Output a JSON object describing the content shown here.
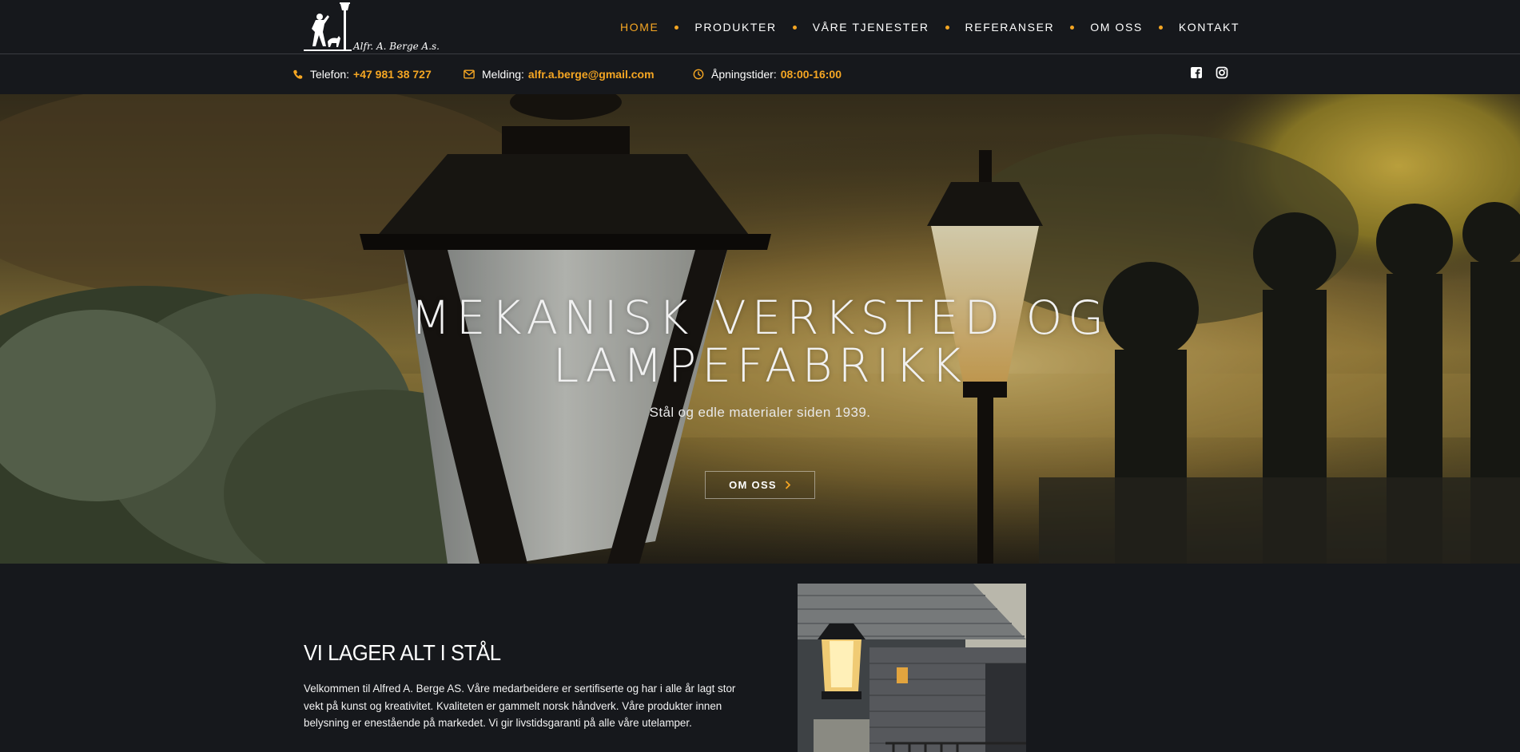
{
  "brand": {
    "logo_alt": "Alfr. A. Berge A.s.",
    "logo_text": "Alfr. A. Berge A.s."
  },
  "nav": [
    {
      "label": "HOME",
      "active": true
    },
    {
      "label": "PRODUKTER",
      "active": false
    },
    {
      "label": "VÅRE TJENESTER",
      "active": false
    },
    {
      "label": "REFERANSER",
      "active": false
    },
    {
      "label": "OM OSS",
      "active": false
    },
    {
      "label": "KONTAKT",
      "active": false
    }
  ],
  "contact": {
    "phone_label": "Telefon:",
    "phone": "+47 981 38 727",
    "email_label": "Melding:",
    "email": "alfr.a.berge@gmail.com",
    "hours_label": "Åpningstider:",
    "hours": "08:00-16:00"
  },
  "social": {
    "icons": [
      "facebook-icon",
      "instagram-icon"
    ]
  },
  "hero": {
    "title_line1": "MEKANISK VERKSTED OG",
    "title_line2": "LAMPEFABRIKK",
    "subtitle": "Stål og edle materialer siden 1939.",
    "button_label": "OM OSS"
  },
  "intro": {
    "heading": "VI LAGER ALT I STÅL",
    "body": "Velkommen til Alfred A. Berge AS. Våre medarbeidere er sertifiserte og har i alle år lagt stor vekt på kunst og kreativitet. Kvaliteten er gammelt norsk håndverk. Våre produkter innen belysning er enestående på markedet. Vi gir livstidsgaranti på alle våre utelamper."
  },
  "colors": {
    "accent": "#f5a623",
    "background": "#16181c",
    "text": "#ffffff"
  }
}
